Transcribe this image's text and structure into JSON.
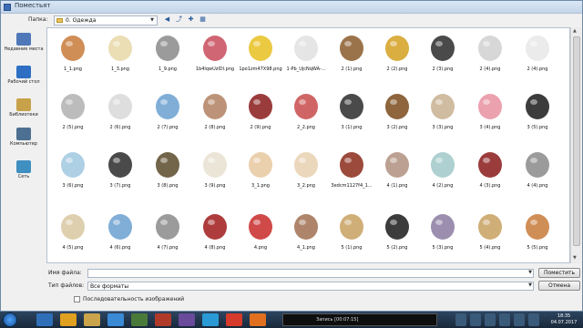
{
  "window": {
    "title": "Поместьят"
  },
  "address": {
    "label": "Папка:",
    "folder_value": "0. Одежда"
  },
  "sidebar": [
    {
      "label": "Недавние места",
      "icon": "recent-places-icon"
    },
    {
      "label": "Рабочий стол",
      "icon": "desktop-icon"
    },
    {
      "label": "Библиотеки",
      "icon": "libraries-icon"
    },
    {
      "label": "Компьютер",
      "icon": "computer-icon"
    },
    {
      "label": "Сеть",
      "icon": "network-icon"
    }
  ],
  "files": [
    "1_1.png",
    "1_3.png",
    "1_9.png",
    "1b4lqwUzlDl.png",
    "1po1zm47X98.png",
    "1-Pb_UjcNqWA-...",
    "2 (1).png",
    "2 (2).png",
    "2 (3).png",
    "2 (4).png",
    "2 (4).png",
    "2 (5).png",
    "2 (6).png",
    "2 (7).png",
    "2 (8).png",
    "2 (9).png",
    "2_2.png",
    "3 (1).png",
    "3 (2).png",
    "3 (3).png",
    "3 (4).png",
    "3 (5).png",
    "3 (6).png",
    "3 (7).png",
    "3 (8).png",
    "3 (9).png",
    "3_1.png",
    "3_2.png",
    "3edcm1127f4_1...",
    "4 (1).png",
    "4 (2).png",
    "4 (3).png",
    "4 (4).png",
    "4 (5).png",
    "4 (6).png",
    "4 (7).png",
    "4 (8).png",
    "4.png",
    "4_1.png",
    "5 (1).png",
    "5 (2).png",
    "5 (3).png",
    "5 (4).png",
    "5 (5).png"
  ],
  "filename": {
    "label": "Имя файла:",
    "value": ""
  },
  "filetype": {
    "label": "Тип файлов:",
    "value": "Все форматы"
  },
  "buttons": {
    "open": "Поместить",
    "cancel": "Отмена"
  },
  "sequence_checkbox": {
    "label": "Последовательность изображений",
    "checked": false
  },
  "taskbar": {
    "recording": {
      "label": "Запись [00:07:15]"
    },
    "clock": {
      "time": "18:35",
      "date": "04.07.2017"
    }
  }
}
